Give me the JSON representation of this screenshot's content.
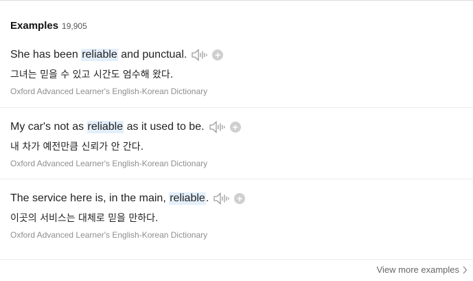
{
  "header": {
    "title": "Examples",
    "count": "19,905"
  },
  "examples": [
    {
      "pre": "She has been ",
      "highlight": "reliable",
      "post": " and punctual.",
      "translation": "그녀는 믿을 수 있고 시간도 엄수해 왔다.",
      "source": "Oxford Advanced Learner's English-Korean Dictionary"
    },
    {
      "pre": "My car's not as ",
      "highlight": "reliable",
      "post": " as it used to be.",
      "translation": "내 차가 예전만큼 신뢰가 안 간다.",
      "source": "Oxford Advanced Learner's English-Korean Dictionary"
    },
    {
      "pre": "The service here is, in the main, ",
      "highlight": "reliable",
      "post": ".",
      "translation": "이곳의 서비스는 대체로 믿을 만하다.",
      "source": "Oxford Advanced Learner's English-Korean Dictionary"
    }
  ],
  "icons": {
    "speaker": "speaker-icon",
    "add": "plus-circle-icon",
    "chevron": "chevron-right-icon"
  },
  "footer": {
    "view_more_label": "View more examples"
  },
  "colors": {
    "highlight": "#e3effa",
    "source_text": "#8e8e8e"
  }
}
